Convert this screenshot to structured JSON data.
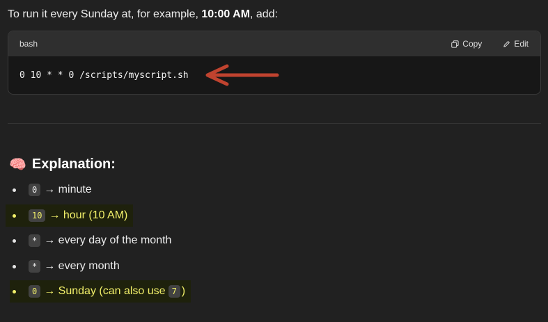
{
  "intro": {
    "prefix": "To run it every Sunday at, for example, ",
    "time": "10:00 AM",
    "suffix": ", add:"
  },
  "code_block": {
    "language": "bash",
    "copy_label": "Copy",
    "edit_label": "Edit",
    "code": "0 10 * * 0 /scripts/myscript.sh",
    "arrow_color": "#c0432f"
  },
  "explanation": {
    "emoji": "🧠",
    "title": "Explanation:",
    "items": [
      {
        "code": "0",
        "text": "→ minute",
        "highlighted": false
      },
      {
        "code": "10",
        "text": "→ hour (10 AM)",
        "highlighted": true
      },
      {
        "code": "*",
        "text": "→ every day of the month",
        "highlighted": false
      },
      {
        "code": "*",
        "text": "→ every month",
        "highlighted": false
      },
      {
        "code": "0",
        "text": "→ Sunday (can also use ",
        "code2": "7",
        "text2": ")",
        "highlighted": true
      }
    ]
  },
  "colors": {
    "background": "#212121",
    "code_bg": "#171717",
    "highlight_bg": "#1e210c",
    "highlight_text": "#f2f06a"
  }
}
